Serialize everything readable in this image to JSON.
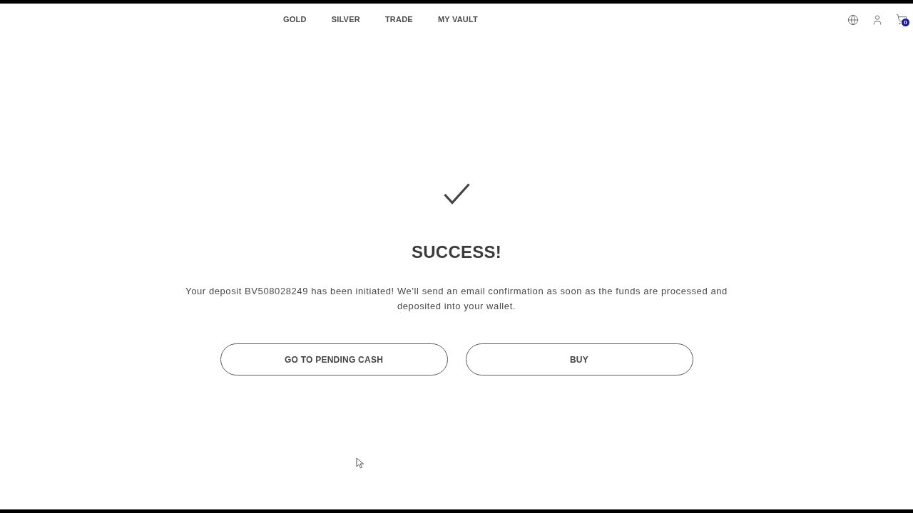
{
  "nav": {
    "links": [
      {
        "label": "GOLD"
      },
      {
        "label": "SILVER"
      },
      {
        "label": "TRADE"
      },
      {
        "label": "MY VAULT"
      }
    ],
    "cart": {
      "count": "0"
    }
  },
  "result": {
    "title": "SUCCESS!",
    "message": "Your deposit BV508028249 has been initiated! We'll send an email confirmation as soon as the funds are processed and deposited into your wallet."
  },
  "buttons": [
    {
      "label": "GO TO PENDING CASH"
    },
    {
      "label": "BUY"
    }
  ]
}
